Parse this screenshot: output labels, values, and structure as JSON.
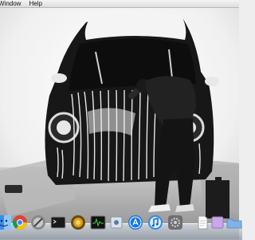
{
  "menubar": {
    "items": [
      "Window",
      "Help"
    ]
  },
  "dock": {
    "icons": [
      "finder-icon",
      "chrome-icon",
      "system-utility-icon",
      "terminal-icon",
      "photo-app-icon",
      "activity-monitor-icon",
      "preview-icon",
      "app-store-icon",
      "itunes-icon",
      "system-preferences-icon",
      "document-icon",
      "document-icon-2",
      "folder-icon"
    ]
  },
  "colors": {
    "desktop_bg": "#efefef",
    "dock_shelf": "#b8c0ca",
    "car_body": "#1b1b1b",
    "paint_white": "#f2f2f2"
  }
}
